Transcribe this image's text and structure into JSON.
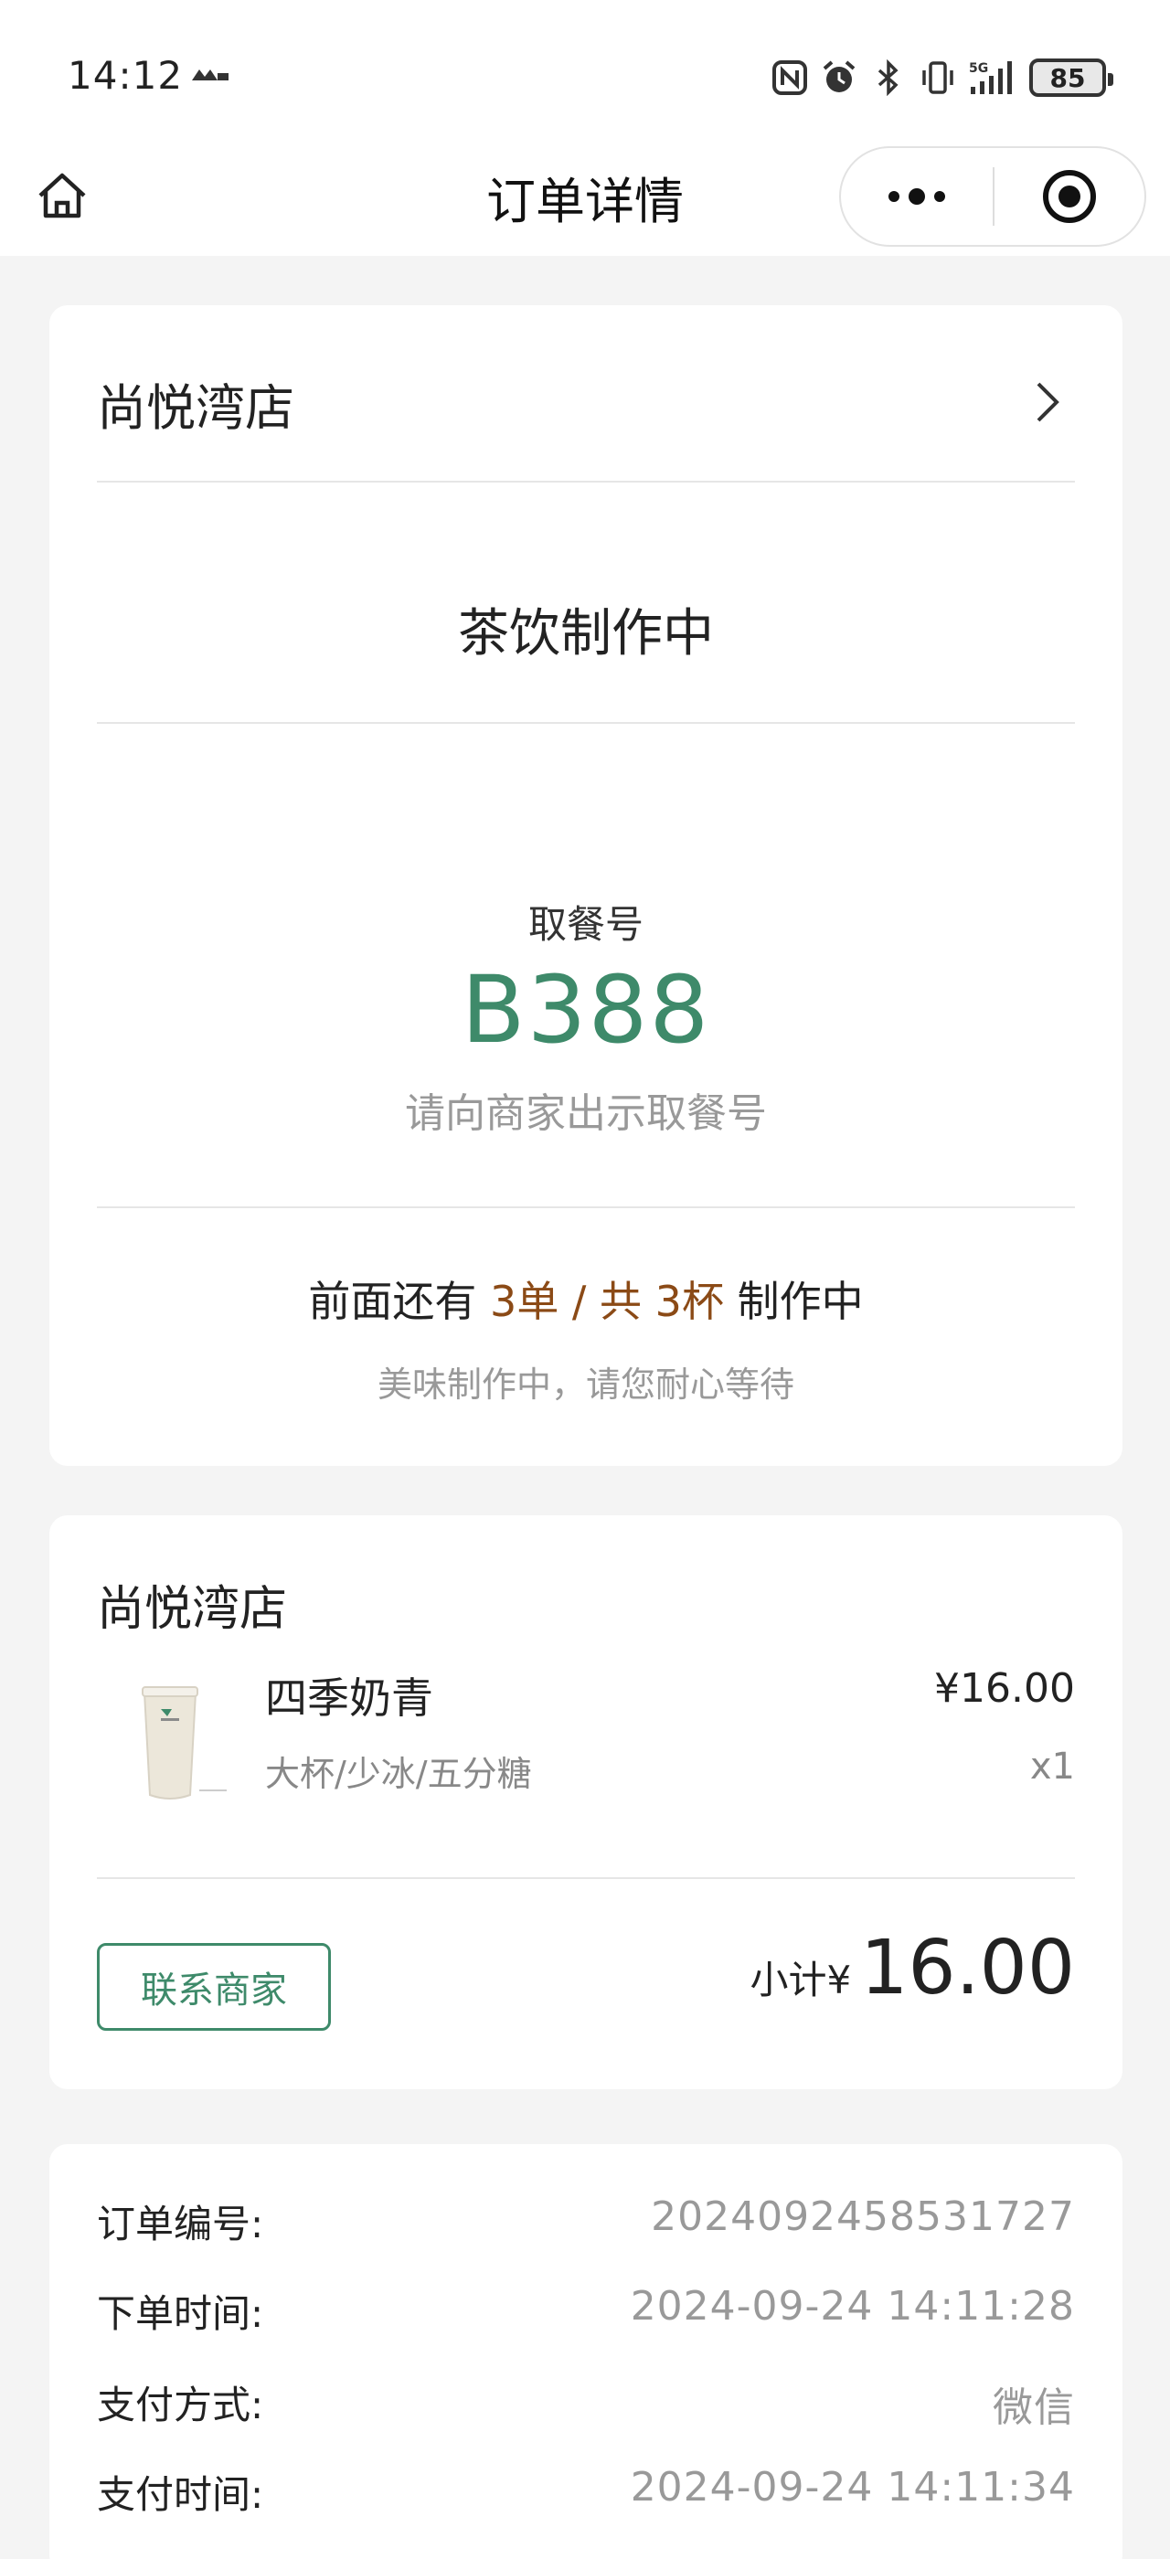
{
  "status_bar": {
    "time": "14:12",
    "battery": "85",
    "icons": [
      "nfc-icon",
      "alarm-icon",
      "bluetooth-icon",
      "vibrate-icon",
      "signal-5g-icon"
    ]
  },
  "navbar": {
    "title": "订单详情"
  },
  "order_status": {
    "store_name": "尚悦湾店",
    "status": "茶饮制作中",
    "pickup_label": "取餐号",
    "pickup_number": "B388",
    "pickup_hint": "请向商家出示取餐号",
    "queue_prefix": "前面还有 ",
    "queue_highlight": "3单 / 共 3杯",
    "queue_suffix": " 制作中",
    "queue_sub": "美味制作中，请您耐心等待"
  },
  "order_items": {
    "store_name": "尚悦湾店",
    "items": [
      {
        "name": "四季奶青",
        "price": "¥16.00",
        "spec": "大杯/少冰/五分糖",
        "qty": "x1"
      }
    ],
    "contact_button": "联系商家",
    "subtotal_label": "小计¥",
    "subtotal_amount": "16.00"
  },
  "order_info": [
    {
      "label": "订单编号:",
      "value": "2024092458531727"
    },
    {
      "label": "下单时间:",
      "value": "2024-09-24 14:11:28"
    },
    {
      "label": "支付方式:",
      "value": "微信"
    },
    {
      "label": "支付时间:",
      "value": "2024-09-24 14:11:34"
    }
  ],
  "colors": {
    "accent_green": "#3e8a6a",
    "highlight_brown": "#8b4a16",
    "background": "#f4f4f4"
  }
}
